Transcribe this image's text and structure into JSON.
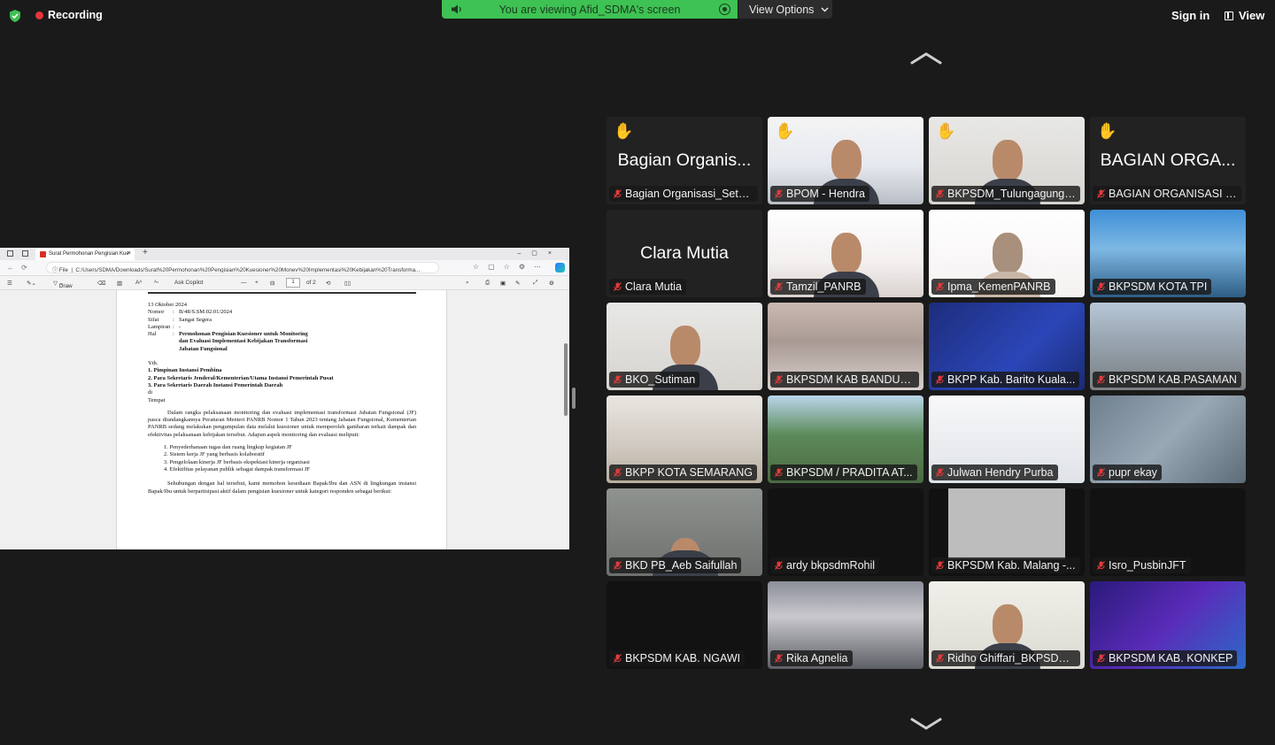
{
  "topbar": {
    "recording_label": "Recording",
    "viewing_label": "You are viewing Afid_SDMA's screen",
    "view_options_label": "View Options",
    "sign_in_label": "Sign in",
    "view_label": "View"
  },
  "shared_screen": {
    "tab_title": "Surat Permohonan Pengisian Kue",
    "url_prefix": "File",
    "url": "C:/Users/SDMA/Downloads/Surat%20Permohonan%20Pengisian%20Kuesioner%20Monev%20Implementasi%20Kebijakan%20Transforma...",
    "tool_draw": "Draw",
    "tool_copilot": "Ask Copilot",
    "page_current": "1",
    "page_total": "of 2",
    "letter": {
      "nomor_label": "Nomor",
      "nomor": "B/48/S.SM.02.01/2024",
      "date": "13 Oktober 2024",
      "sifat_label": "Sifat",
      "sifat": "Sangat Segera",
      "lampiran_label": "Lampiran",
      "lampiran": "-",
      "hal_label": "Hal",
      "hal": "Permohonan Pengisian Kuesioner untuk Monitoring dan Evaluasi Implementasi Kebijakan Transformasi Jabatan Fungsional",
      "yth": "Yth.",
      "recipients": [
        "1. Pimpinan Instansi Pembina",
        "2. Para Sekretaris Jenderal/Kementerian/Utama Instansi Pemerintah Pusat",
        "3. Para Sekretaris Daerah Instansi Pemerintah Daerah"
      ],
      "di": "di",
      "tempat": "Tempat",
      "para1": "Dalam rangka pelaksanaan monitoring dan evaluasi implementasi transformasi Jabatan Fungsional (JF) pasca diundangkannya Peraturan Menteri PANRB Nomor 1 Tahun 2023 tentang Jabatan Fungsional, Kementerian PANRB sedang melakukan pengumpulan data melalui kuesioner untuk memperoleh gambaran terkait dampak dan efektivitas pelaksanaan kebijakan tersebut. Adapun aspek monitoring dan evaluasi meliputi:",
      "aspects": [
        "1. Penyederhanaan tugas dan ruang lingkup kegiatan JF",
        "2. Sistem kerja JF yang berbasis kolaboratif",
        "3. Pengelolaan kinerja JF berbasis ekspektasi kinerja organisasi",
        "4. Efektifitas pelayanan publik sebagai dampak transformasi JF"
      ],
      "para2": "Sehubungan dengan hal tersebut, kami memohon kesediaan Bapak/Ibu dan ASN di lingkungan instansi Bapak/Ibu untuk berpartisipasi aktif dalam pengisian kuesioner untuk kategori responden sebagai berikut:"
    }
  },
  "participants": [
    {
      "name": "Bagian Organisasi_Setd...",
      "big": "Bagian Organis...",
      "hand": true,
      "video": "none"
    },
    {
      "name": "BPOM - Hendra",
      "hand": true,
      "video": "banner"
    },
    {
      "name": "BKPSDM_Tulungagung_...",
      "hand": true,
      "video": "person"
    },
    {
      "name": "BAGIAN ORGANISASI K...",
      "big": "BAGIAN ORGA...",
      "hand": true,
      "video": "none"
    },
    {
      "name": "Clara Mutia",
      "big": "Clara Mutia",
      "video": "none"
    },
    {
      "name": "Tamzil_PANRB",
      "video": "panrb"
    },
    {
      "name": "Ipma_KemenPANRB",
      "video": "panrb2",
      "active": true
    },
    {
      "name": "BKPSDM KOTA TPI",
      "video": "building"
    },
    {
      "name": "BKO_Sutiman",
      "video": "person"
    },
    {
      "name": "BKPSDM KAB BANDUN...",
      "video": "blur"
    },
    {
      "name": "BKPP Kab. Barito Kuala...",
      "video": "bkpp"
    },
    {
      "name": "BKPSDM KAB.PASAMAN",
      "video": "city"
    },
    {
      "name": "BKPP KOTA SEMARANG",
      "video": "blurlight"
    },
    {
      "name": "BKPSDM / PRADITA AT...",
      "video": "office"
    },
    {
      "name": "Julwan Hendry Purba",
      "video": "slide"
    },
    {
      "name": "pupr ekay",
      "video": "pupr"
    },
    {
      "name": "BKD PB_Aeb Saifullah",
      "video": "room"
    },
    {
      "name": "ardy bkpsdmRohil",
      "video": "black"
    },
    {
      "name": "BKPSDM Kab. Malang -...",
      "video": "gray"
    },
    {
      "name": "Isro_PusbinJFT",
      "video": "black"
    },
    {
      "name": "BKPSDM KAB. NGAWI",
      "video": "black"
    },
    {
      "name": "Rika Agnelia",
      "video": "blurroom"
    },
    {
      "name": "Ridho Ghiffari_BKPSDM...",
      "video": "person2"
    },
    {
      "name": "BKPSDM KAB. KONKEP",
      "video": "purple"
    }
  ]
}
